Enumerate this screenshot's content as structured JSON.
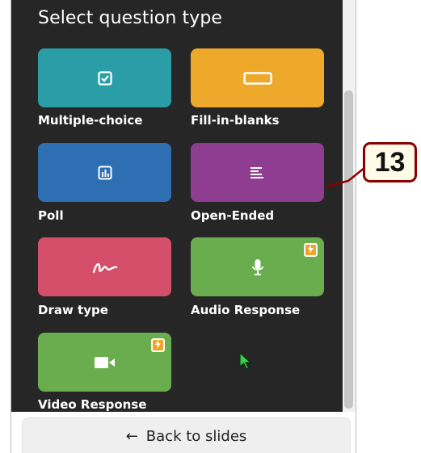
{
  "panel": {
    "title": "Select question type"
  },
  "tiles": [
    {
      "label": "Multiple-choice",
      "icon": "checkbox-icon",
      "color": "#2a9da6",
      "premium": false
    },
    {
      "label": "Fill-in-blanks",
      "icon": "blank-box-icon",
      "color": "#eea82a",
      "premium": false
    },
    {
      "label": "Poll",
      "icon": "bar-chart-icon",
      "color": "#2e6fb4",
      "premium": false
    },
    {
      "label": "Open-Ended",
      "icon": "text-lines-icon",
      "color": "#8f3d91",
      "premium": false
    },
    {
      "label": "Draw type",
      "icon": "squiggle-icon",
      "color": "#d54e6a",
      "premium": false
    },
    {
      "label": "Audio Response",
      "icon": "microphone-icon",
      "color": "#6aad4e",
      "premium": true
    },
    {
      "label": "Video Response",
      "icon": "video-camera-icon",
      "color": "#6aad4e",
      "premium": true
    }
  ],
  "premium_badge_icon": "lightning-icon",
  "footer": {
    "back_label": "Back to slides",
    "back_icon": "left-arrow-icon"
  },
  "annotation": {
    "number": "13",
    "border_color": "#8b0000"
  }
}
